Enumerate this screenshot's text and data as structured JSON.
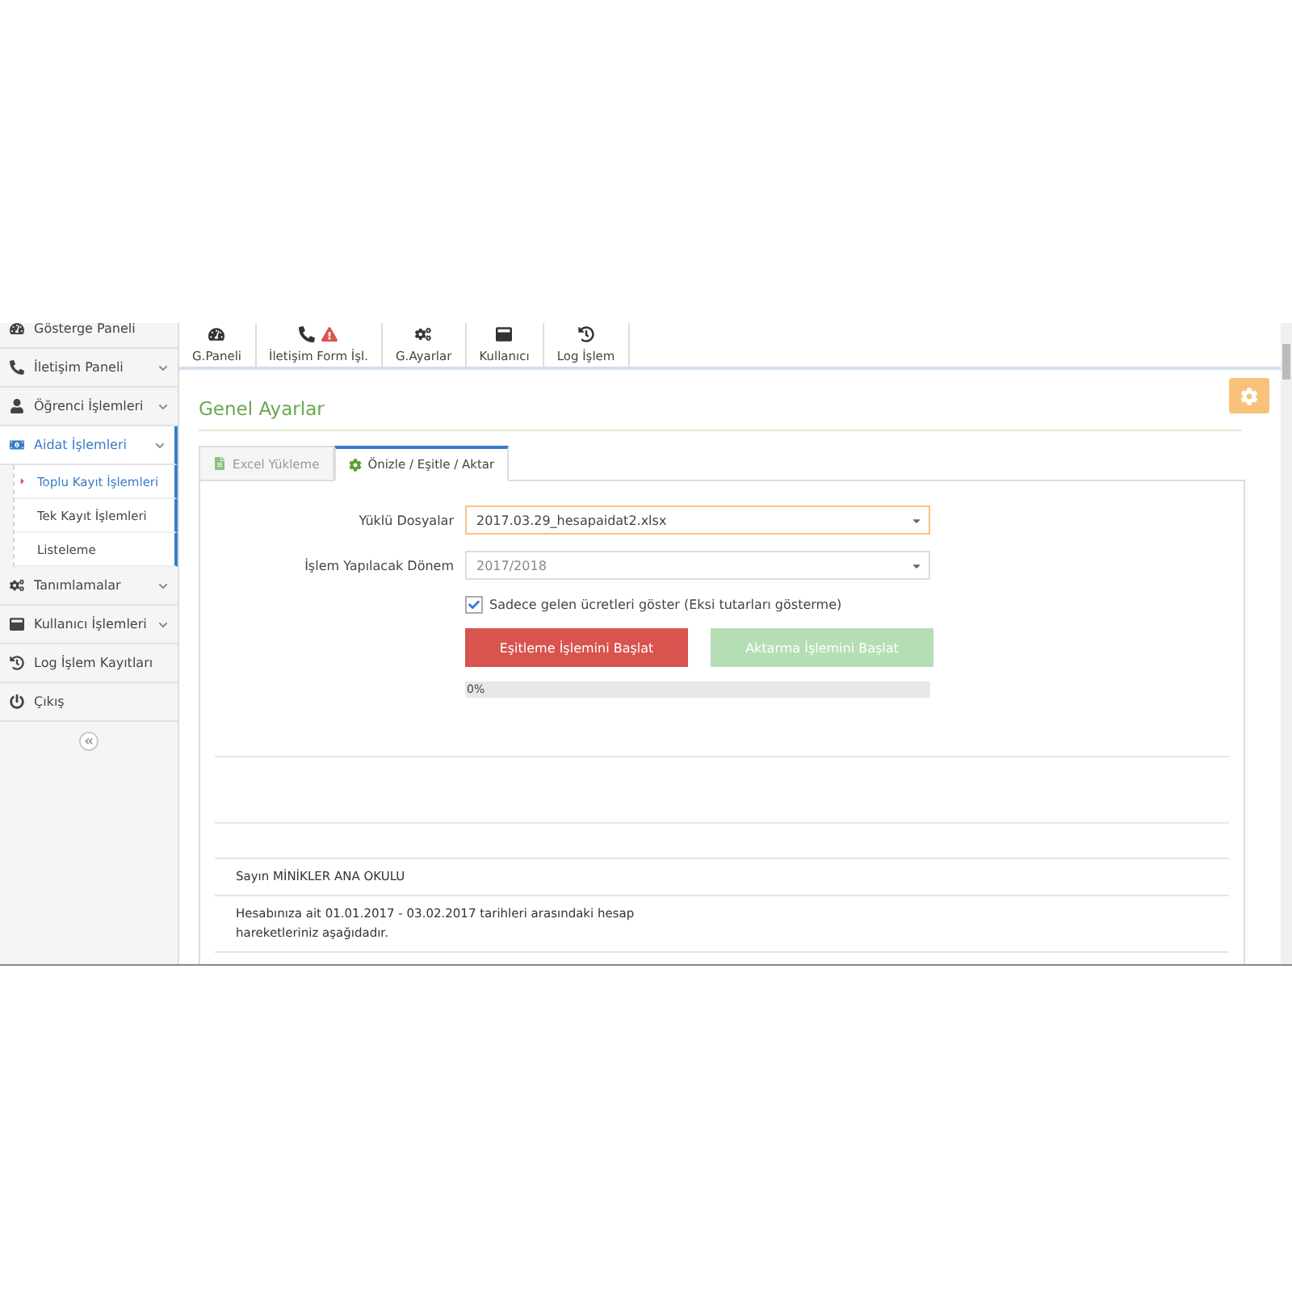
{
  "sidebar": {
    "items": [
      {
        "label": "Gösterge Paneli",
        "expandable": false,
        "selected": false
      },
      {
        "label": "İletişim Paneli",
        "expandable": true,
        "selected": false
      },
      {
        "label": "Öğrenci İşlemleri",
        "expandable": true,
        "selected": false
      },
      {
        "label": "Aidat İşlemleri",
        "expandable": true,
        "expanded": true,
        "selected": true,
        "children": [
          {
            "label": "Toplu Kayıt İşlemleri",
            "selected": true
          },
          {
            "label": "Tek Kayıt İşlemleri",
            "selected": false
          },
          {
            "label": "Listeleme",
            "selected": false
          }
        ]
      },
      {
        "label": "Tanımlamalar",
        "expandable": true,
        "selected": false
      },
      {
        "label": "Kullanıcı İşlemleri",
        "expandable": true,
        "selected": false
      },
      {
        "label": "Log İşlem Kayıtları",
        "expandable": false,
        "selected": false
      },
      {
        "label": "Çıkış",
        "expandable": false,
        "selected": false
      }
    ]
  },
  "toolbar": [
    {
      "label": "G.Paneli",
      "alert": false
    },
    {
      "label": "İletişim Form İşl.",
      "alert": true
    },
    {
      "label": "G.Ayarlar",
      "alert": false
    },
    {
      "label": "Kullanıcı",
      "alert": false
    },
    {
      "label": "Log İşlem",
      "alert": false
    }
  ],
  "page_title": "Genel Ayarlar",
  "tabs": [
    {
      "label": "Excel Yükleme",
      "selected": false
    },
    {
      "label": "Önizle / Eşitle / Aktar",
      "selected": true
    }
  ],
  "fields": [
    {
      "label": "Yüklü Dosyalar",
      "value": "2017.03.29_hesapaidat2.xlsx",
      "focused": true,
      "disabled": false
    },
    {
      "label": "İşlem Yapılacak Dönem",
      "value": "2017/2018",
      "focused": false,
      "disabled": true
    }
  ],
  "checkbox": {
    "label": "Sadece gelen ücretleri göster (Eksi tutarları gösterme)",
    "checked": true
  },
  "buttons": [
    {
      "label": "Eşitleme İşlemini Başlat",
      "kind": "danger",
      "disabled": false
    },
    {
      "label": "Aktarma İşlemini Başlat",
      "kind": "success",
      "disabled": true
    }
  ],
  "progress": {
    "level": 0,
    "reading": "0%"
  },
  "message": {
    "greeting": "Sayın MİNİKLER ANA OKULU",
    "text": "Hesabınıza ait 01.01.2017 - 03.02.2017 tarihleri arasındaki hesap hareketleriniz aşağıdadır."
  }
}
